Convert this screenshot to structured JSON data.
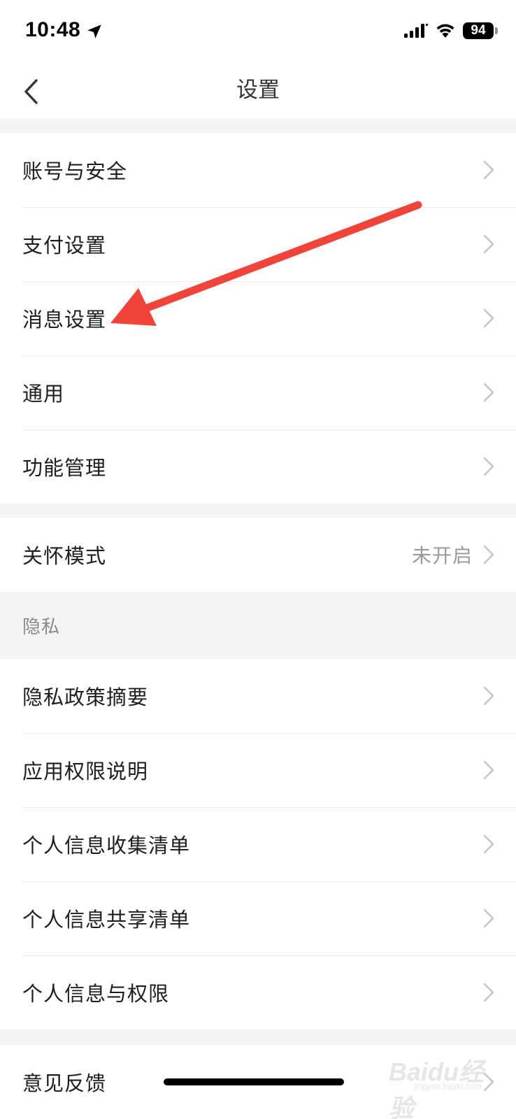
{
  "status_bar": {
    "time": "10:48",
    "location_icon": "location-arrow-icon",
    "signal_icon": "cellular-signal-icon",
    "wifi_icon": "wifi-icon",
    "battery_level": "94"
  },
  "nav": {
    "back_icon": "chevron-left-icon",
    "title": "设置"
  },
  "groups": {
    "main": [
      {
        "label": "账号与安全"
      },
      {
        "label": "支付设置"
      },
      {
        "label": "消息设置"
      },
      {
        "label": "通用"
      },
      {
        "label": "功能管理"
      }
    ],
    "care": [
      {
        "label": "关怀模式",
        "value": "未开启"
      }
    ],
    "privacy_header": "隐私",
    "privacy": [
      {
        "label": "隐私政策摘要"
      },
      {
        "label": "应用权限说明"
      },
      {
        "label": "个人信息收集清单"
      },
      {
        "label": "个人信息共享清单"
      },
      {
        "label": "个人信息与权限"
      }
    ],
    "feedback": [
      {
        "label": "意见反馈"
      }
    ]
  },
  "annotation": {
    "color": "#f0443a",
    "icon": "red-arrow-annotation"
  },
  "watermark": {
    "text": "Baidu经验",
    "sub": "jingyan.baidu.com"
  },
  "colors": {
    "background": "#f4f4f4",
    "surface": "#ffffff",
    "text": "#1e1e1e",
    "secondary_text": "#9a9a9a",
    "chevron": "#c4c4c4"
  }
}
